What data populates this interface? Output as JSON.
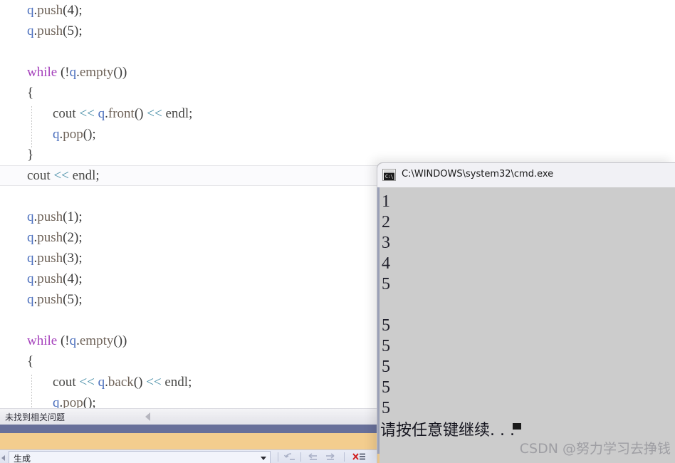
{
  "editor": {
    "lines": [
      {
        "indent": 1,
        "tokens": [
          {
            "t": "q",
            "c": "var"
          },
          {
            "t": ".",
            "c": "pun"
          },
          {
            "t": "push",
            "c": "fn"
          },
          {
            "t": "(",
            "c": "pun"
          },
          {
            "t": "4",
            "c": "num"
          },
          {
            "t": ")",
            "c": "pun"
          },
          {
            "t": ";",
            "c": "pun"
          }
        ]
      },
      {
        "indent": 1,
        "tokens": [
          {
            "t": "q",
            "c": "var"
          },
          {
            "t": ".",
            "c": "pun"
          },
          {
            "t": "push",
            "c": "fn"
          },
          {
            "t": "(",
            "c": "pun"
          },
          {
            "t": "5",
            "c": "num"
          },
          {
            "t": ")",
            "c": "pun"
          },
          {
            "t": ";",
            "c": "pun"
          }
        ]
      },
      {
        "indent": 1,
        "tokens": []
      },
      {
        "indent": 1,
        "tokens": [
          {
            "t": "while",
            "c": "kw"
          },
          {
            "t": " (",
            "c": "pun"
          },
          {
            "t": "!",
            "c": "pun"
          },
          {
            "t": "q",
            "c": "var"
          },
          {
            "t": ".",
            "c": "pun"
          },
          {
            "t": "empty",
            "c": "fn"
          },
          {
            "t": "())",
            "c": "pun"
          }
        ]
      },
      {
        "indent": 1,
        "tokens": [
          {
            "t": "{",
            "c": "pun"
          }
        ]
      },
      {
        "indent": 2,
        "tokens": [
          {
            "t": "cout",
            "c": "id"
          },
          {
            "t": " ",
            "c": "pun"
          },
          {
            "t": "<<",
            "c": "op"
          },
          {
            "t": " ",
            "c": "pun"
          },
          {
            "t": "q",
            "c": "var"
          },
          {
            "t": ".",
            "c": "pun"
          },
          {
            "t": "front",
            "c": "fn"
          },
          {
            "t": "()",
            "c": "pun"
          },
          {
            "t": " ",
            "c": "pun"
          },
          {
            "t": "<<",
            "c": "op"
          },
          {
            "t": " ",
            "c": "pun"
          },
          {
            "t": "endl",
            "c": "id"
          },
          {
            "t": ";",
            "c": "pun"
          }
        ]
      },
      {
        "indent": 2,
        "tokens": [
          {
            "t": "q",
            "c": "var"
          },
          {
            "t": ".",
            "c": "pun"
          },
          {
            "t": "pop",
            "c": "fn"
          },
          {
            "t": "()",
            "c": "pun"
          },
          {
            "t": ";",
            "c": "pun"
          }
        ]
      },
      {
        "indent": 1,
        "tokens": [
          {
            "t": "}",
            "c": "pun"
          }
        ]
      },
      {
        "indent": 1,
        "current": true,
        "tokens": [
          {
            "t": "cout",
            "c": "id"
          },
          {
            "t": " ",
            "c": "pun"
          },
          {
            "t": "<<",
            "c": "op"
          },
          {
            "t": " ",
            "c": "pun"
          },
          {
            "t": "endl",
            "c": "id"
          },
          {
            "t": ";",
            "c": "pun"
          }
        ]
      },
      {
        "indent": 1,
        "tokens": []
      },
      {
        "indent": 1,
        "tokens": [
          {
            "t": "q",
            "c": "var"
          },
          {
            "t": ".",
            "c": "pun"
          },
          {
            "t": "push",
            "c": "fn"
          },
          {
            "t": "(",
            "c": "pun"
          },
          {
            "t": "1",
            "c": "num"
          },
          {
            "t": ")",
            "c": "pun"
          },
          {
            "t": ";",
            "c": "pun"
          }
        ]
      },
      {
        "indent": 1,
        "tokens": [
          {
            "t": "q",
            "c": "var"
          },
          {
            "t": ".",
            "c": "pun"
          },
          {
            "t": "push",
            "c": "fn"
          },
          {
            "t": "(",
            "c": "pun"
          },
          {
            "t": "2",
            "c": "num"
          },
          {
            "t": ")",
            "c": "pun"
          },
          {
            "t": ";",
            "c": "pun"
          }
        ]
      },
      {
        "indent": 1,
        "tokens": [
          {
            "t": "q",
            "c": "var"
          },
          {
            "t": ".",
            "c": "pun"
          },
          {
            "t": "push",
            "c": "fn"
          },
          {
            "t": "(",
            "c": "pun"
          },
          {
            "t": "3",
            "c": "num"
          },
          {
            "t": ")",
            "c": "pun"
          },
          {
            "t": ";",
            "c": "pun"
          }
        ]
      },
      {
        "indent": 1,
        "tokens": [
          {
            "t": "q",
            "c": "var"
          },
          {
            "t": ".",
            "c": "pun"
          },
          {
            "t": "push",
            "c": "fn"
          },
          {
            "t": "(",
            "c": "pun"
          },
          {
            "t": "4",
            "c": "num"
          },
          {
            "t": ")",
            "c": "pun"
          },
          {
            "t": ";",
            "c": "pun"
          }
        ]
      },
      {
        "indent": 1,
        "tokens": [
          {
            "t": "q",
            "c": "var"
          },
          {
            "t": ".",
            "c": "pun"
          },
          {
            "t": "push",
            "c": "fn"
          },
          {
            "t": "(",
            "c": "pun"
          },
          {
            "t": "5",
            "c": "num"
          },
          {
            "t": ")",
            "c": "pun"
          },
          {
            "t": ";",
            "c": "pun"
          }
        ]
      },
      {
        "indent": 1,
        "tokens": []
      },
      {
        "indent": 1,
        "tokens": [
          {
            "t": "while",
            "c": "kw"
          },
          {
            "t": " (",
            "c": "pun"
          },
          {
            "t": "!",
            "c": "pun"
          },
          {
            "t": "q",
            "c": "var"
          },
          {
            "t": ".",
            "c": "pun"
          },
          {
            "t": "empty",
            "c": "fn"
          },
          {
            "t": "())",
            "c": "pun"
          }
        ]
      },
      {
        "indent": 1,
        "tokens": [
          {
            "t": "{",
            "c": "pun"
          }
        ]
      },
      {
        "indent": 2,
        "tokens": [
          {
            "t": "cout",
            "c": "id"
          },
          {
            "t": " ",
            "c": "pun"
          },
          {
            "t": "<<",
            "c": "op"
          },
          {
            "t": " ",
            "c": "pun"
          },
          {
            "t": "q",
            "c": "var"
          },
          {
            "t": ".",
            "c": "pun"
          },
          {
            "t": "back",
            "c": "fn"
          },
          {
            "t": "()",
            "c": "pun"
          },
          {
            "t": " ",
            "c": "pun"
          },
          {
            "t": "<<",
            "c": "op"
          },
          {
            "t": " ",
            "c": "pun"
          },
          {
            "t": "endl",
            "c": "id"
          },
          {
            "t": ";",
            "c": "pun"
          }
        ]
      },
      {
        "indent": 2,
        "tokens": [
          {
            "t": "q",
            "c": "var"
          },
          {
            "t": ".",
            "c": "pun"
          },
          {
            "t": "pop",
            "c": "fn"
          },
          {
            "t": "()",
            "c": "pun"
          },
          {
            "t": ";",
            "c": "pun"
          }
        ]
      }
    ]
  },
  "status_bar": {
    "text": "未找到相关问题",
    "collapse_icon": "triangle-left-icon"
  },
  "bottom_toolbar": {
    "build_combo_value": "生成",
    "icons": [
      {
        "name": "undo-arrow-icon",
        "glyph": "↵"
      },
      {
        "name": "previous-arrow-icon",
        "glyph": "←"
      },
      {
        "name": "next-arrow-icon",
        "glyph": "→"
      },
      {
        "name": "clear-list-icon",
        "glyph": "✖"
      }
    ]
  },
  "console": {
    "title": "C:\\WINDOWS\\system32\\cmd.exe",
    "icon_name": "cmd-icon",
    "icon_text": "C:\\",
    "output_lines": [
      "1",
      "2",
      "3",
      "4",
      "5",
      "",
      "5",
      "5",
      "5",
      "5",
      "5"
    ],
    "prompt": "请按任意键继续. . ."
  },
  "watermark": {
    "text": "CSDN @努力学习去挣钱"
  },
  "colors": {
    "console_bg": "#cccccc",
    "console_titlebar": "#f1f1f5",
    "purple_bar": "#68709a",
    "orange_bar": "#f3cd8e",
    "status_bar": "#e9e9ee",
    "keyword": "#a43fbb",
    "variable": "#4b6fbd",
    "operator": "#4a8fa8",
    "function": "#6e6258"
  }
}
